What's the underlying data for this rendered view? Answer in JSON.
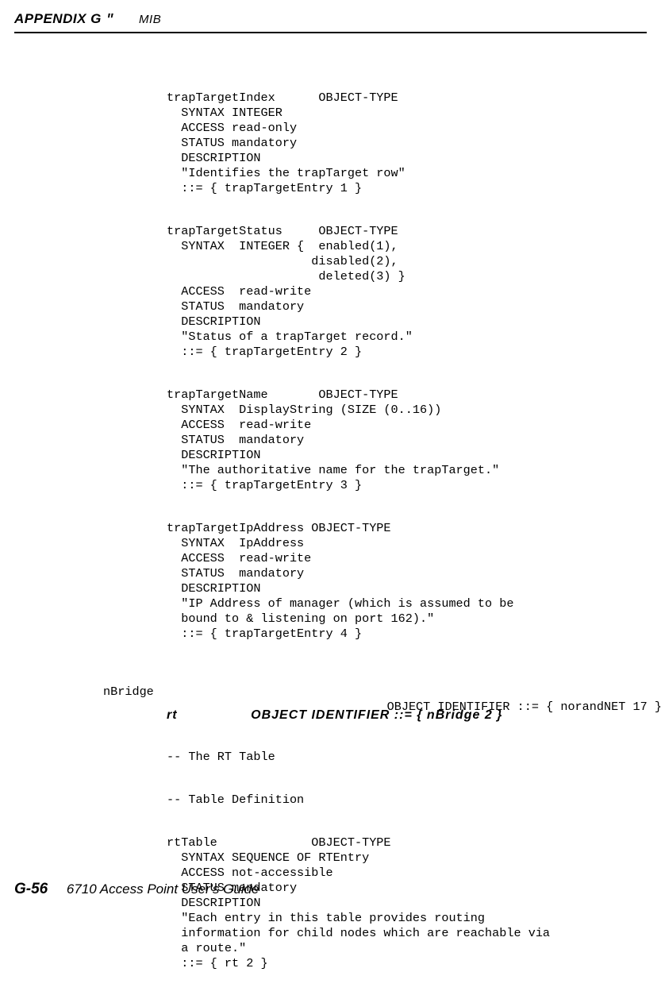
{
  "header": {
    "appendix": "APPENDIX G",
    "bullet": "\"",
    "section": "MIB"
  },
  "blocks": {
    "trapTargetIndex": "trapTargetIndex      OBJECT-TYPE\n  SYNTAX INTEGER\n  ACCESS read-only\n  STATUS mandatory\n  DESCRIPTION\n  \"Identifies the trapTarget row\"\n  ::= { trapTargetEntry 1 }",
    "trapTargetStatus": "trapTargetStatus     OBJECT-TYPE\n  SYNTAX  INTEGER {  enabled(1),\n                    disabled(2),\n                     deleted(3) }\n  ACCESS  read-write\n  STATUS  mandatory\n  DESCRIPTION\n  \"Status of a trapTarget record.\"\n  ::= { trapTargetEntry 2 }",
    "trapTargetName": "trapTargetName       OBJECT-TYPE\n  SYNTAX  DisplayString (SIZE (0..16))\n  ACCESS  read-write\n  STATUS  mandatory\n  DESCRIPTION\n  \"The authoritative name for the trapTarget.\"\n  ::= { trapTargetEntry 3 }",
    "trapTargetIpAddress": "trapTargetIpAddress OBJECT-TYPE\n  SYNTAX  IpAddress\n  ACCESS  read-write\n  STATUS  mandatory\n  DESCRIPTION\n  \"IP Address of manager (which is assumed to be\n  bound to & listening on port 162).\"\n  ::= { trapTargetEntry 4 }",
    "nBridgeLabel": "nBridge",
    "nBridgeLine": "              OBJECT IDENTIFIER ::= { norandNET 17 }",
    "rtHeading": "rt                 OBJECT IDENTIFIER ::= { nBridge 2 }",
    "rtComment1": "-- The RT Table",
    "rtComment2": "-- Table Definition",
    "rtTable": "rtTable             OBJECT-TYPE\n  SYNTAX SEQUENCE OF RTEntry\n  ACCESS not-accessible\n  STATUS mandatory\n  DESCRIPTION\n  \"Each entry in this table provides routing\n  information for child nodes which are reachable via\n  a route.\"\n  ::= { rt 2 }"
  },
  "footer": {
    "pagenum": "G-56",
    "title": "6710 Access Point User's Guide"
  }
}
